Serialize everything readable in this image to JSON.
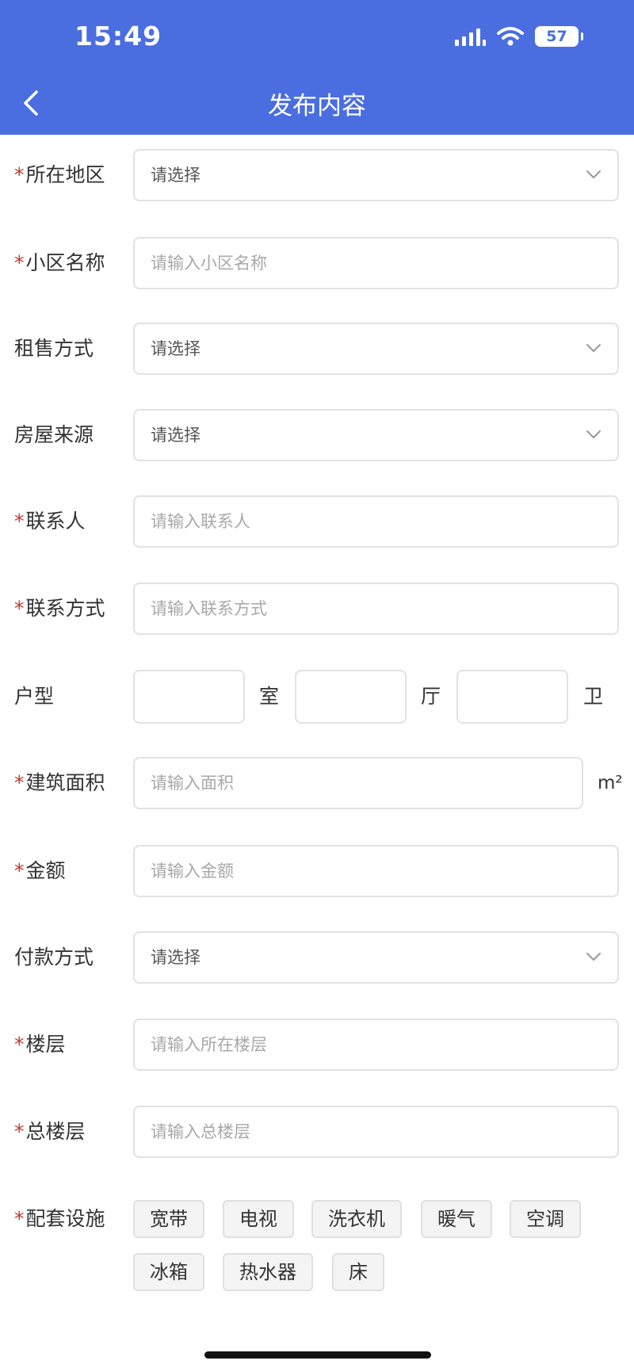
{
  "status_bar": {
    "time": "15:49",
    "battery": "57"
  },
  "header": {
    "title": "发布内容"
  },
  "form": {
    "region": {
      "required_mark": "*",
      "label": "所在地区",
      "placeholder": "请选择"
    },
    "community": {
      "required_mark": "*",
      "label": "小区名称",
      "placeholder": "请输入小区名称"
    },
    "rent_sale_method": {
      "label": "租售方式",
      "placeholder": "请选择"
    },
    "house_source": {
      "label": "房屋来源",
      "placeholder": "请选择"
    },
    "contact_person": {
      "required_mark": "*",
      "label": "联系人",
      "placeholder": "请输入联系人"
    },
    "contact_method": {
      "required_mark": "*",
      "label": "联系方式",
      "placeholder": "请输入联系方式"
    },
    "layout": {
      "label": "户型",
      "unit_room": "室",
      "unit_hall": "厅",
      "unit_bath": "卫"
    },
    "area": {
      "required_mark": "*",
      "label": "建筑面积",
      "placeholder": "请输入面积",
      "unit": "m²"
    },
    "amount": {
      "required_mark": "*",
      "label": "金额",
      "placeholder": "请输入金额"
    },
    "payment_method": {
      "label": "付款方式",
      "placeholder": "请选择"
    },
    "floor": {
      "required_mark": "*",
      "label": "楼层",
      "placeholder": "请输入所在楼层"
    },
    "total_floors": {
      "required_mark": "*",
      "label": "总楼层",
      "placeholder": "请输入总楼层"
    },
    "facilities": {
      "required_mark": "*",
      "label": "配套设施",
      "options": [
        "宽带",
        "电视",
        "洗衣机",
        "暖气",
        "空调",
        "冰箱",
        "热水器",
        "床"
      ]
    }
  },
  "colors": {
    "header_bg": "#4a6ee0",
    "required_mark": "#c0392b",
    "border": "#e2e2e2",
    "placeholder": "#a8a8a8"
  },
  "icons": {
    "back": "chevron-left-icon",
    "dropdown": "chevron-down-icon",
    "signal": "cellular-signal-icon",
    "wifi": "wifi-icon",
    "battery": "battery-icon"
  }
}
